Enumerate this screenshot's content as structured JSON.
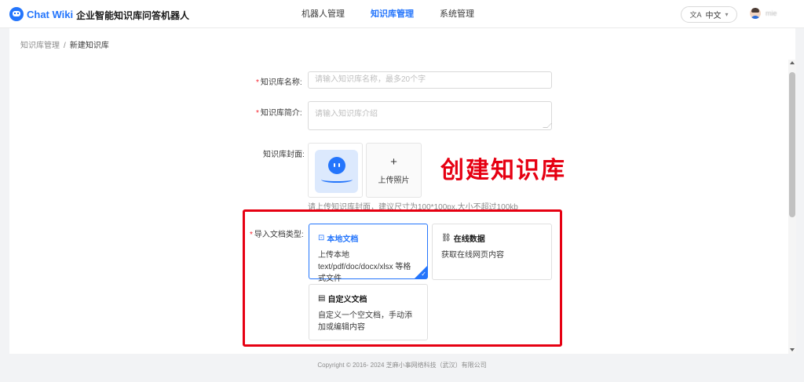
{
  "header": {
    "logo_text": "Chat Wiki",
    "app_title": "企业智能知识库问答机器人",
    "nav": [
      {
        "label": "机器人管理"
      },
      {
        "label": "知识库管理"
      },
      {
        "label": "系统管理"
      }
    ],
    "language": "中文",
    "username": "mie"
  },
  "breadcrumb": {
    "parent": "知识库管理",
    "separator": "/",
    "current": "新建知识库"
  },
  "form": {
    "name": {
      "label": "知识库名称:",
      "placeholder": "请输入知识库名称，最多20个字"
    },
    "intro": {
      "label": "知识库简介:",
      "placeholder": "请输入知识库介绍"
    },
    "cover": {
      "label": "知识库封面:",
      "upload_label": "上传照片",
      "upload_symbol": "+",
      "hint": "请上传知识库封面，建议尺寸为100*100px,大小不超过100kb"
    },
    "doc_type": {
      "label": "导入文档类型:",
      "options": [
        {
          "title": "本地文档",
          "icon": "upload-doc-icon",
          "desc": "上传本地 text/pdf/doc/docx/xlsx 等格式文件",
          "selected": true
        },
        {
          "title": "在线数据",
          "icon": "link-icon",
          "desc": "获取在线网页内容",
          "selected": false
        },
        {
          "title": "自定义文档",
          "icon": "document-icon",
          "desc": "自定义一个空文档，手动添加或编辑内容",
          "selected": false
        }
      ]
    }
  },
  "annotation": "创建知识库",
  "footer": {
    "copyright": "Copyright © 2016- 2024 芝麻小事网络科技（武汉）有限公司"
  },
  "colors": {
    "primary": "#2475fc",
    "annotation": "#e60012",
    "required": "#f5222d"
  }
}
